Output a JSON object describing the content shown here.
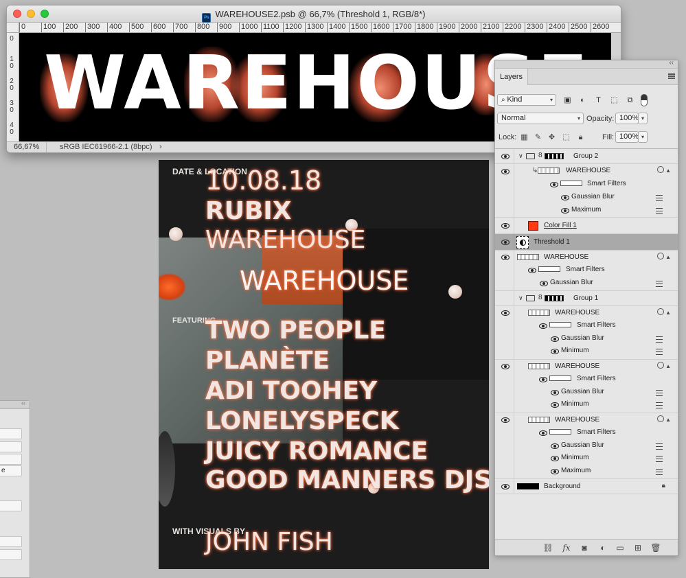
{
  "document": {
    "title": "WAREHOUSE2.psb @ 66,7% (Threshold 1, RGB/8*)",
    "psb_badge": "Ps",
    "ruler_h": [
      "0",
      "100",
      "200",
      "300",
      "400",
      "500",
      "600",
      "700",
      "800",
      "900",
      "1000",
      "1100",
      "1200",
      "1300",
      "1400",
      "1500",
      "1600",
      "1700",
      "1800",
      "1900",
      "2000",
      "2100",
      "2200",
      "2300",
      "2400",
      "2500",
      "2600"
    ],
    "ruler_v": [
      "0",
      "1",
      "0",
      "2",
      "0",
      "3",
      "0",
      "4",
      "0"
    ],
    "canvas_word": "WAREHOUSE",
    "zoom": "66,67%",
    "profile": "sRGB IEC61966-2.1 (8bpc)",
    "status_arrow": "›"
  },
  "poster": {
    "date_label": "DATE & LOCATION",
    "date": "10.08.18",
    "venue1": "RUBIX",
    "venue2": "WAREHOUSE",
    "headline": "WAREHOUSE",
    "featuring_label": "FEATURING",
    "artists": [
      "TWO PEOPLE",
      "PLANÈTE",
      "ADI TOOHEY",
      "LONELYSPECK",
      "JUICY ROMANCE",
      "GOOD MANNERS DJS"
    ],
    "visuals_label": "WITH VISUALS BY",
    "visuals_artist": "JOHN FISH"
  },
  "layers_panel": {
    "tab": "Layers",
    "collapse": "‹‹",
    "filter_kind": "Kind",
    "blend_mode": "Normal",
    "opacity_label": "Opacity:",
    "opacity": "100%",
    "lock_label": "Lock:",
    "fill_label": "Fill:",
    "fill": "100%",
    "layers": [
      {
        "name": "Group 2",
        "type": "group"
      },
      {
        "name": "WAREHOUSE",
        "type": "smart"
      },
      {
        "name": "Smart Filters",
        "type": "sf"
      },
      {
        "name": "Gaussian Blur",
        "type": "filter"
      },
      {
        "name": "Maximum",
        "type": "filter"
      },
      {
        "name": "Color Fill 1",
        "type": "fill",
        "color": "#ff3b16"
      },
      {
        "name": "Threshold 1",
        "type": "adj",
        "selected": true
      },
      {
        "name": "WAREHOUSE",
        "type": "smart"
      },
      {
        "name": "Smart Filters",
        "type": "sf"
      },
      {
        "name": "Gaussian Blur",
        "type": "filter"
      },
      {
        "name": "Group 1",
        "type": "group"
      },
      {
        "name": "WAREHOUSE",
        "type": "smart"
      },
      {
        "name": "Smart Filters",
        "type": "sf"
      },
      {
        "name": "Gaussian Blur",
        "type": "filter"
      },
      {
        "name": "Minimum",
        "type": "filter"
      },
      {
        "name": "WAREHOUSE",
        "type": "smart"
      },
      {
        "name": "Smart Filters",
        "type": "sf"
      },
      {
        "name": "Gaussian Blur",
        "type": "filter"
      },
      {
        "name": "Minimum",
        "type": "filter"
      },
      {
        "name": "WAREHOUSE",
        "type": "smart"
      },
      {
        "name": "Smart Filters",
        "type": "sf"
      },
      {
        "name": "Gaussian Blur",
        "type": "filter"
      },
      {
        "name": "Minimum",
        "type": "filter"
      },
      {
        "name": "Maximum",
        "type": "filter"
      },
      {
        "name": "Background",
        "type": "bg"
      }
    ],
    "bottom_icons": [
      "link-layers-icon",
      "fx-icon",
      "add-mask-icon",
      "adjustment-layer-icon",
      "new-group-icon",
      "new-layer-icon",
      "delete-icon"
    ],
    "fx_glyph": "fx"
  },
  "left_panel": {
    "field_text": "e"
  }
}
